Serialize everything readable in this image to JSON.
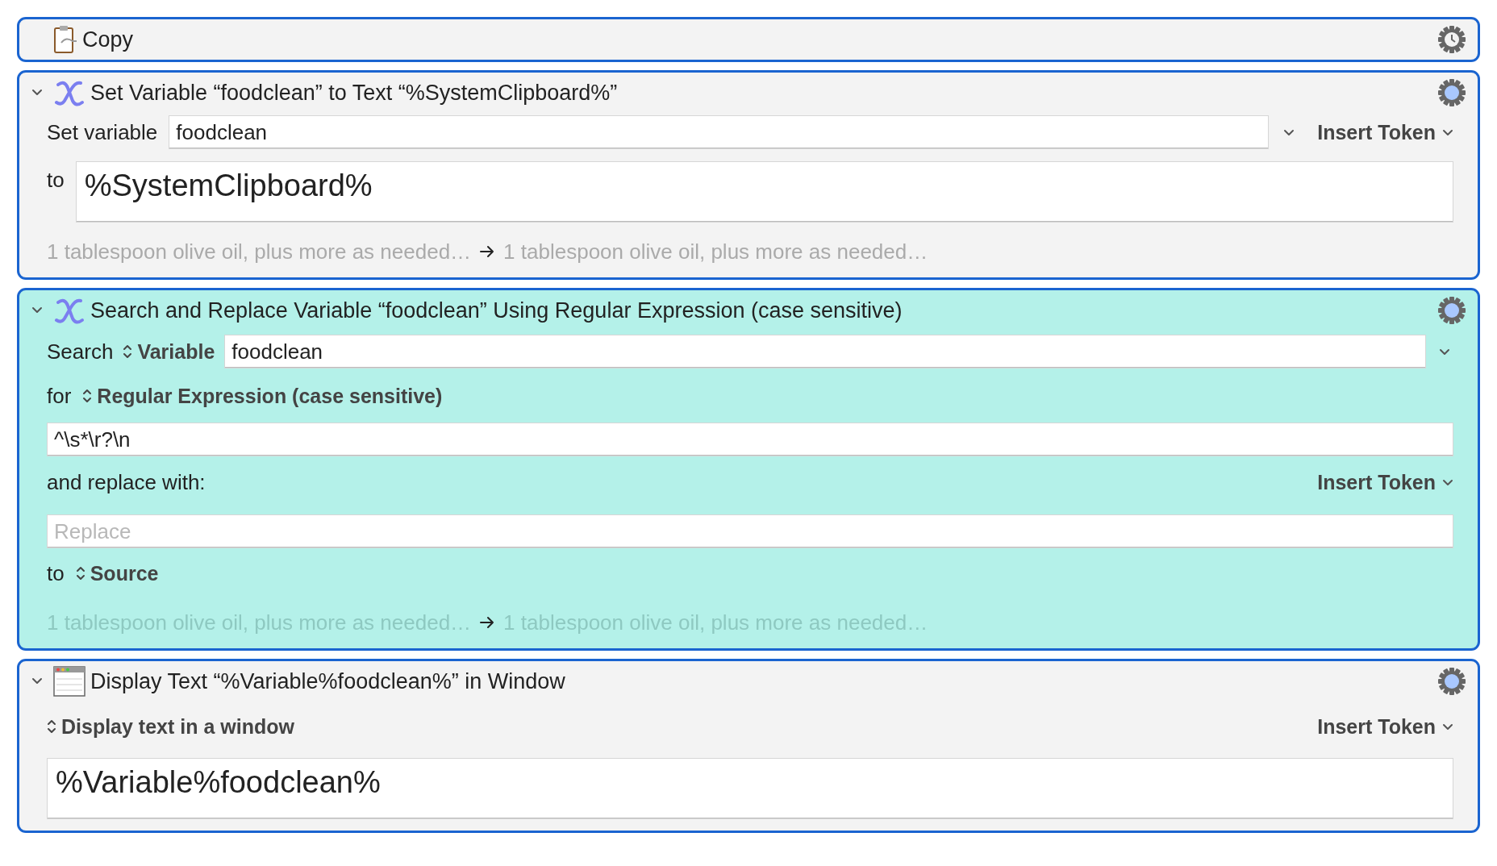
{
  "actions": [
    {
      "kind": "copy",
      "title": "Copy",
      "selected": false
    },
    {
      "kind": "set-variable",
      "title": "Set Variable “foodclean” to Text “%SystemClipboard%”",
      "expanded": true,
      "selected": false,
      "rows": [
        {
          "kind": "variable",
          "label": "Set variable",
          "value": "foodclean",
          "token": "Insert Token"
        },
        {
          "kind": "textarea",
          "label": "to",
          "value": "%SystemClipboard%"
        },
        {
          "kind": "preview",
          "before": "1 tablespoon olive oil, plus more as needed…",
          "after": "1 tablespoon olive oil, plus more as needed…"
        }
      ]
    },
    {
      "kind": "search-replace",
      "title": "Search and Replace Variable “foodclean” Using Regular Expression (case sensitive)",
      "expanded": true,
      "selected": true,
      "rows": [
        {
          "kind": "search",
          "label": "Search",
          "popup": "Variable",
          "value": "foodclean"
        },
        {
          "kind": "popup",
          "label": "for",
          "popup": "Regular Expression (case sensitive)"
        },
        {
          "kind": "field",
          "value": "^\\s*\\r?\\n"
        },
        {
          "kind": "label-token",
          "label": "and replace with:",
          "token": "Insert Token"
        },
        {
          "kind": "field",
          "placeholder": "Replace"
        },
        {
          "kind": "popup",
          "label": "to",
          "popup": "Source"
        },
        {
          "kind": "preview",
          "before": "1 tablespoon olive oil, plus more as needed…",
          "after": "1 tablespoon olive oil, plus more as needed…"
        }
      ]
    },
    {
      "kind": "display-text",
      "title": "Display Text “%Variable%foodclean%” in Window",
      "expanded": true,
      "selected": false,
      "rows": [
        {
          "kind": "popup-token",
          "popup": "Display text in a window",
          "token": "Insert Token"
        },
        {
          "kind": "textarea",
          "value": "%Variable%foodclean%"
        }
      ]
    }
  ]
}
